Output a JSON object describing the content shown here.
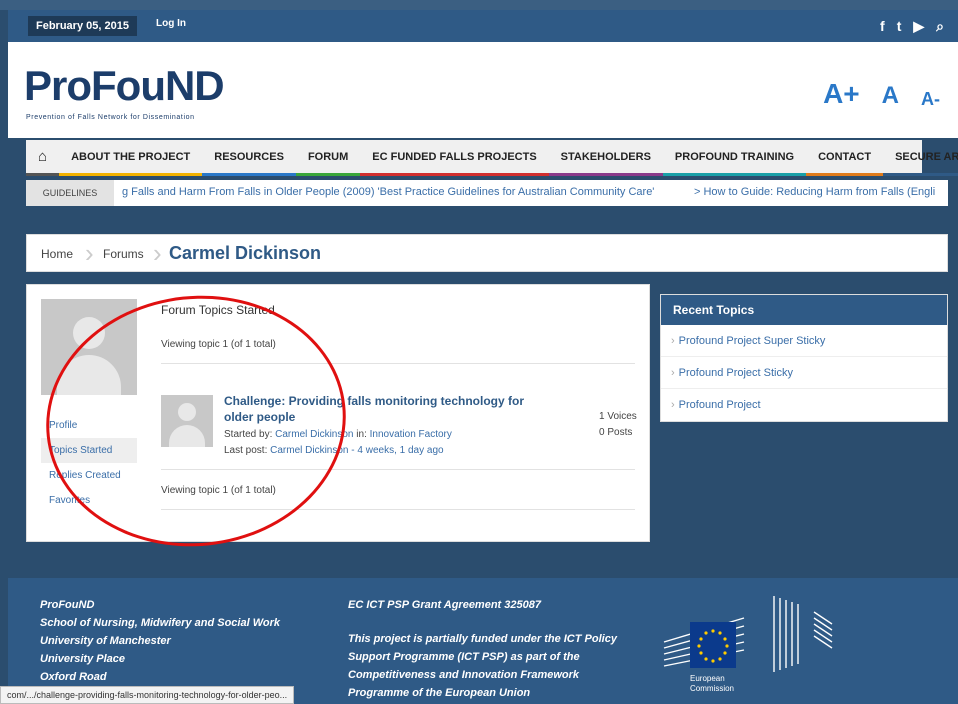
{
  "topbar": {
    "date": "February 05, 2015",
    "login": "Log In",
    "social": [
      "f",
      "t",
      "▶",
      "⌕"
    ]
  },
  "header": {
    "logo": "ProFouND",
    "tagline": "Prevention of Falls Network for Dissemination",
    "font_sizes": [
      "A+",
      "A",
      "A-"
    ]
  },
  "nav": {
    "items": [
      "ABOUT THE PROJECT",
      "RESOURCES",
      "FORUM",
      "EC FUNDED FALLS PROJECTS",
      "STAKEHOLDERS",
      "PROFOUND TRAINING",
      "CONTACT",
      "SECURE AREA"
    ],
    "underline_colors": [
      "#f2b200",
      "#2a78c8",
      "#3aa63a",
      "#d12e2e",
      "#8a3a8a",
      "#19a0a8",
      "#e07b1a",
      "#2f5a86"
    ]
  },
  "ticker": {
    "label": "GUIDELINES",
    "text": "g Falls and Harm From Falls in Older People (2009) 'Best Practice Guidelines for Australian Community Care'",
    "text2": "> How to Guide: Reducing Harm from Falls (Engli"
  },
  "breadcrumb": {
    "home": "Home",
    "forums": "Forums",
    "title": "Carmel Dickinson"
  },
  "profile": {
    "links": [
      "Profile",
      "Topics Started",
      "Replies Created",
      "Favorites"
    ]
  },
  "topics": {
    "heading": "Forum Topics Started",
    "viewing": "Viewing topic 1 (of 1 total)",
    "topic_title": "Challenge: Providing falls monitoring technology for older people",
    "started_by_label": "Started by:",
    "started_by": "Carmel Dickinson",
    "in_label": "in:",
    "forum": "Innovation Factory",
    "last_post_label": "Last post:",
    "last_post_user": "Carmel Dickinson",
    "last_post_time": "4 weeks, 1 day ago",
    "voices": "1 Voices",
    "posts": "0 Posts"
  },
  "sidebar": {
    "heading": "Recent Topics",
    "items": [
      "Profound Project Super Sticky",
      "Profound Project Sticky",
      "Profound Project"
    ]
  },
  "footer": {
    "left": [
      "ProFouND",
      "School of Nursing, Midwifery and Social Work",
      "University of Manchester",
      "University Place",
      "Oxford Road"
    ],
    "grant": "EC ICT PSP Grant Agreement 325087",
    "funding": [
      "This project is partially funded under the ICT Policy",
      "Support Programme (ICT PSP) as part of the",
      "Competitiveness and Innovation Framework",
      "Programme of the European Union"
    ],
    "eu_label": [
      "European",
      "Commission"
    ]
  },
  "statusbar": {
    "url": "com/.../challenge-providing-falls-monitoring-technology-for-older-peo..."
  }
}
